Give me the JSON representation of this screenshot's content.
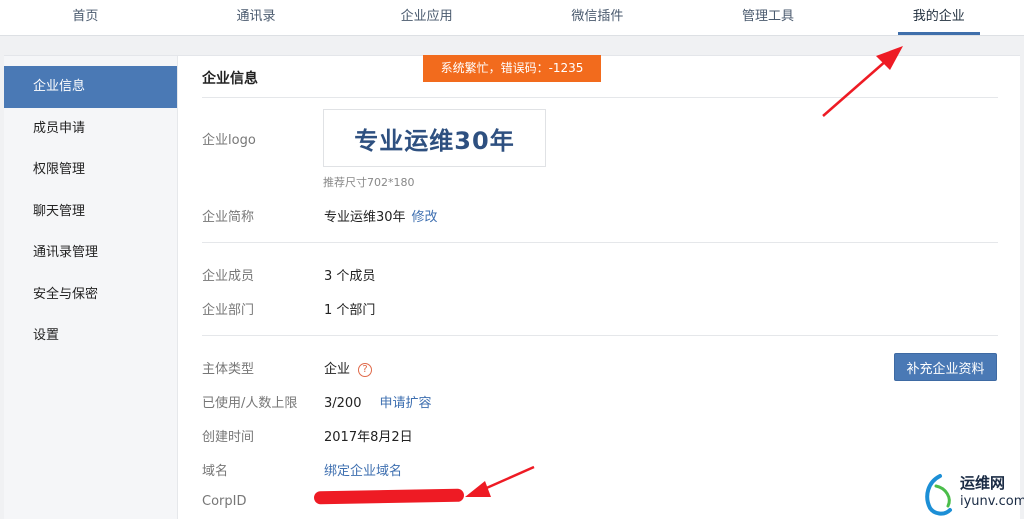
{
  "topnav": {
    "items": [
      {
        "label": "首页"
      },
      {
        "label": "通讯录"
      },
      {
        "label": "企业应用"
      },
      {
        "label": "微信插件"
      },
      {
        "label": "管理工具"
      },
      {
        "label": "我的企业"
      }
    ],
    "active_index": 5
  },
  "sidebar": {
    "items": [
      {
        "label": "企业信息"
      },
      {
        "label": "成员申请"
      },
      {
        "label": "权限管理"
      },
      {
        "label": "聊天管理"
      },
      {
        "label": "通讯录管理"
      },
      {
        "label": "安全与保密"
      },
      {
        "label": "设置"
      }
    ],
    "active_index": 0
  },
  "toast": {
    "text": "系统繁忙，错误码：-1235"
  },
  "main": {
    "title": "企业信息",
    "logo": {
      "label": "企业logo",
      "image_text": "专业运维30年",
      "hint": "推荐尺寸702*180"
    },
    "short_name": {
      "label": "企业简称",
      "value": "专业运维30年",
      "edit_link": "修改"
    },
    "members": {
      "label": "企业成员",
      "value": "3 个成员"
    },
    "departments": {
      "label": "企业部门",
      "value": "1 个部门"
    },
    "entity_type": {
      "label": "主体类型",
      "value": "企业",
      "help": "?"
    },
    "usage": {
      "label": "已使用/人数上限",
      "value": "3/200",
      "link": "申请扩容"
    },
    "created": {
      "label": "创建时间",
      "value": "2017年8月2日"
    },
    "domain": {
      "label": "域名",
      "link": "绑定企业域名"
    },
    "corpid": {
      "label": "CorpID"
    },
    "supplement_button": "补充企业资料"
  },
  "watermark": {
    "line1": "运维网",
    "line2": "iyunv.com"
  },
  "colors": {
    "accent": "#4a79b5",
    "link": "#3e6fb0",
    "toast": "#f26b1d",
    "annotation": "#ee1b24"
  }
}
